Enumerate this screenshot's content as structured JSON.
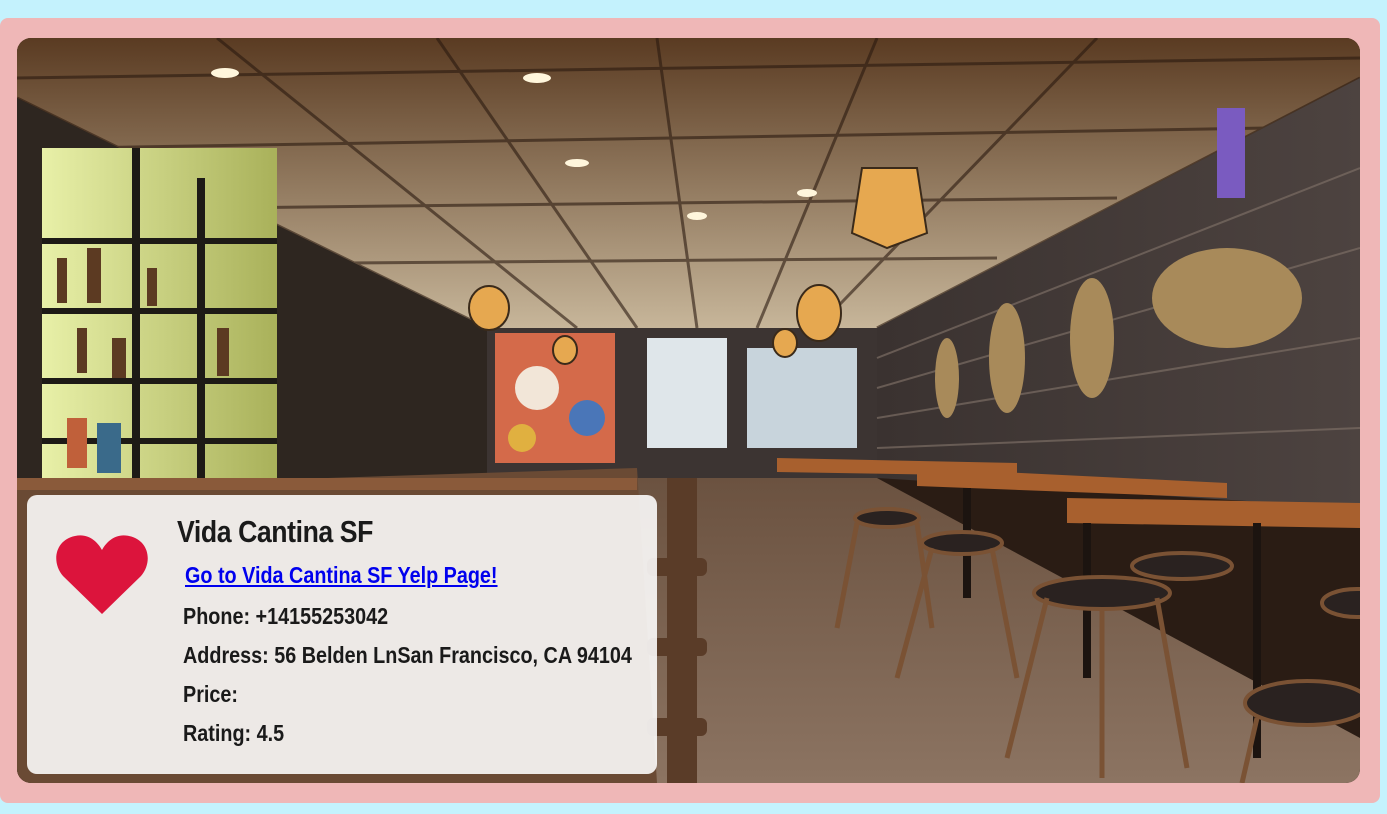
{
  "restaurant": {
    "name": "Vida Cantina SF",
    "yelp_link_text": "Go to Vida Cantina SF Yelp Page!",
    "phone_label": "Phone: +14155253042",
    "address_label": "Address: 56 Belden LnSan Francisco, CA 94104",
    "price_label": "Price:",
    "rating_label": "Rating: 4.5"
  },
  "icons": {
    "favorite": "heart-icon"
  },
  "colors": {
    "page_background": "#c4f2fd",
    "frame": "#efb7b7",
    "heart": "#dc143c",
    "link": "#0000ee"
  }
}
